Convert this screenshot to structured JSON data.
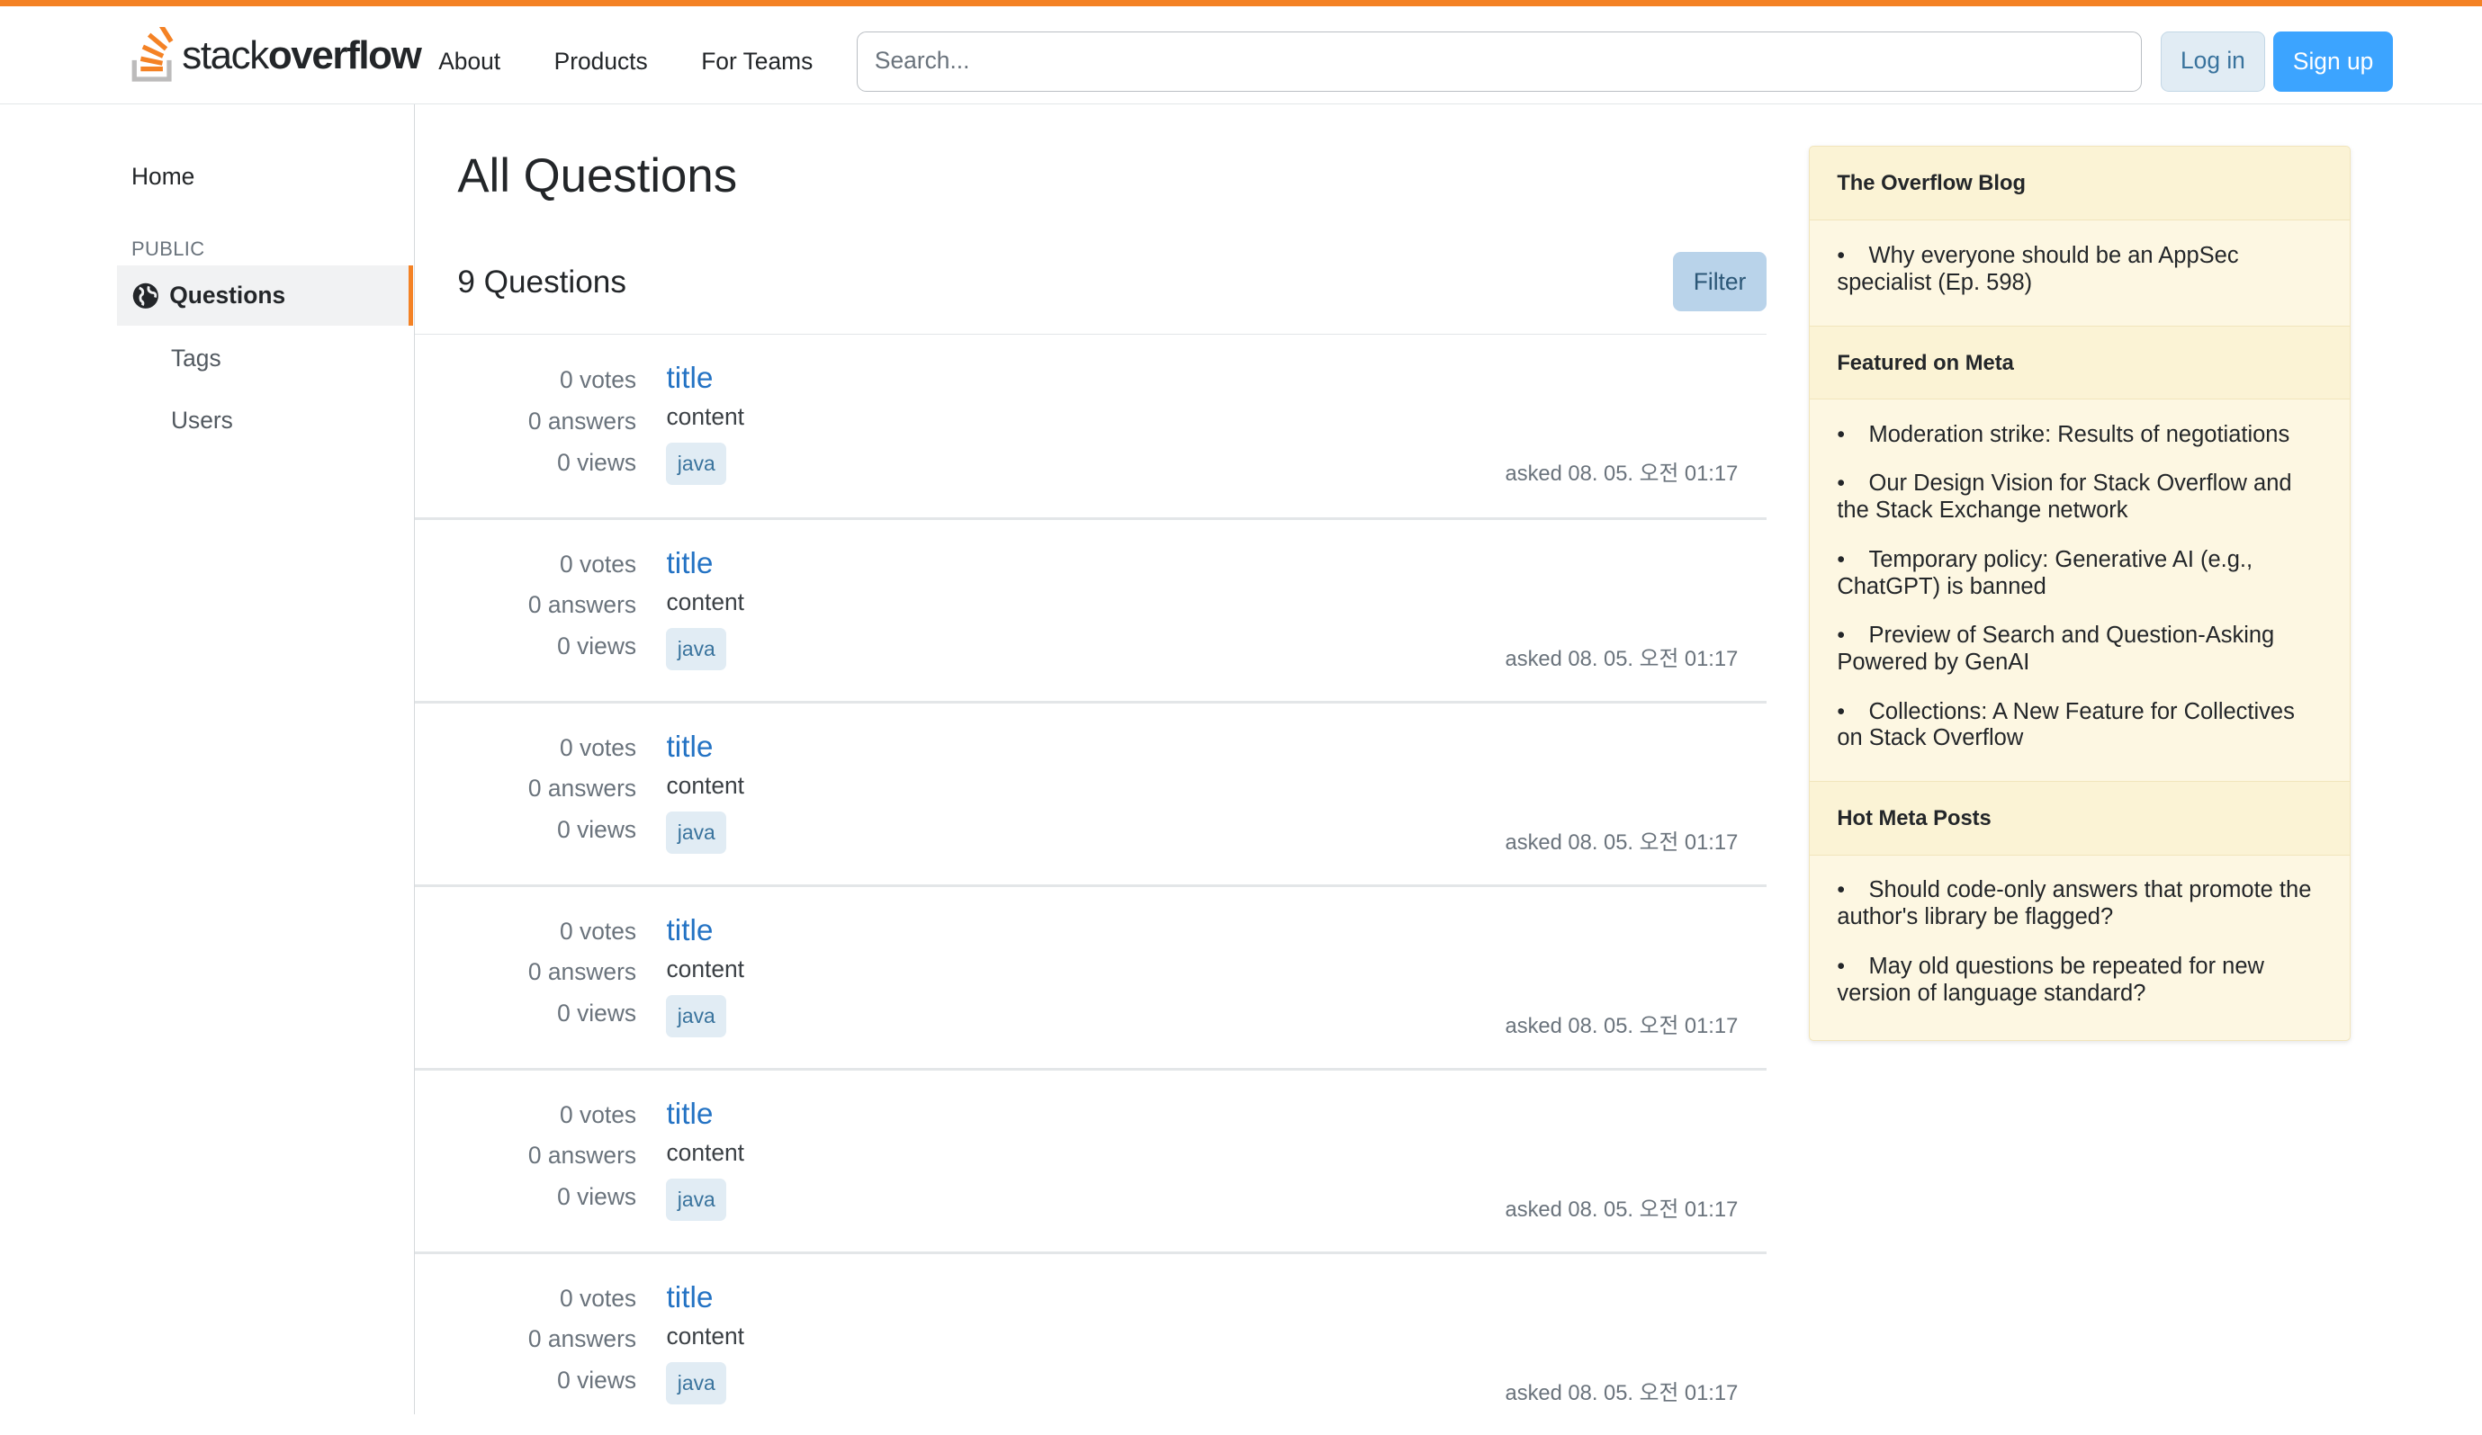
{
  "header": {
    "logo_text_light": "stack",
    "logo_text_bold": "overflow",
    "nav": [
      "About",
      "Products",
      "For Teams"
    ],
    "search_placeholder": "Search...",
    "login_label": "Log in",
    "signup_label": "Sign up",
    "accent_color": "#f48225"
  },
  "sidebar": {
    "home": "Home",
    "section_label": "PUBLIC",
    "questions": "Questions",
    "tags": "Tags",
    "users": "Users"
  },
  "main": {
    "title": "All Questions",
    "count_label": "9 Questions",
    "filter_label": "Filter",
    "questions": [
      {
        "votes": "0 votes",
        "answers": "0 answers",
        "views": "0 views",
        "title": "title",
        "content": "content",
        "tag": "java",
        "asked": "asked 08. 05. 오전 01:17"
      },
      {
        "votes": "0 votes",
        "answers": "0 answers",
        "views": "0 views",
        "title": "title",
        "content": "content",
        "tag": "java",
        "asked": "asked 08. 05. 오전 01:17"
      },
      {
        "votes": "0 votes",
        "answers": "0 answers",
        "views": "0 views",
        "title": "title",
        "content": "content",
        "tag": "java",
        "asked": "asked 08. 05. 오전 01:17"
      },
      {
        "votes": "0 votes",
        "answers": "0 answers",
        "views": "0 views",
        "title": "title",
        "content": "content",
        "tag": "java",
        "asked": "asked 08. 05. 오전 01:17"
      },
      {
        "votes": "0 votes",
        "answers": "0 answers",
        "views": "0 views",
        "title": "title",
        "content": "content",
        "tag": "java",
        "asked": "asked 08. 05. 오전 01:17"
      },
      {
        "votes": "0 votes",
        "answers": "0 answers",
        "views": "0 views",
        "title": "title",
        "content": "content",
        "tag": "java",
        "asked": "asked 08. 05. 오전 01:17"
      }
    ]
  },
  "rightbar": {
    "blog_heading": "The Overflow Blog",
    "blog_items": [
      "Why everyone should be an AppSec specialist (Ep. 598)"
    ],
    "meta_heading": "Featured on Meta",
    "meta_items": [
      "Moderation strike: Results of negotiations",
      "Our Design Vision for Stack Overflow and the Stack Exchange network",
      "Temporary policy: Generative AI (e.g., ChatGPT) is banned",
      "Preview of Search and Question-Asking Powered by GenAI",
      "Collections: A New Feature for Collectives on Stack Overflow"
    ],
    "hot_heading": "Hot Meta Posts",
    "hot_items": [
      "Should code-only answers that promote the author's library be flagged?",
      "May old questions be repeated for new version of language standard?"
    ]
  }
}
